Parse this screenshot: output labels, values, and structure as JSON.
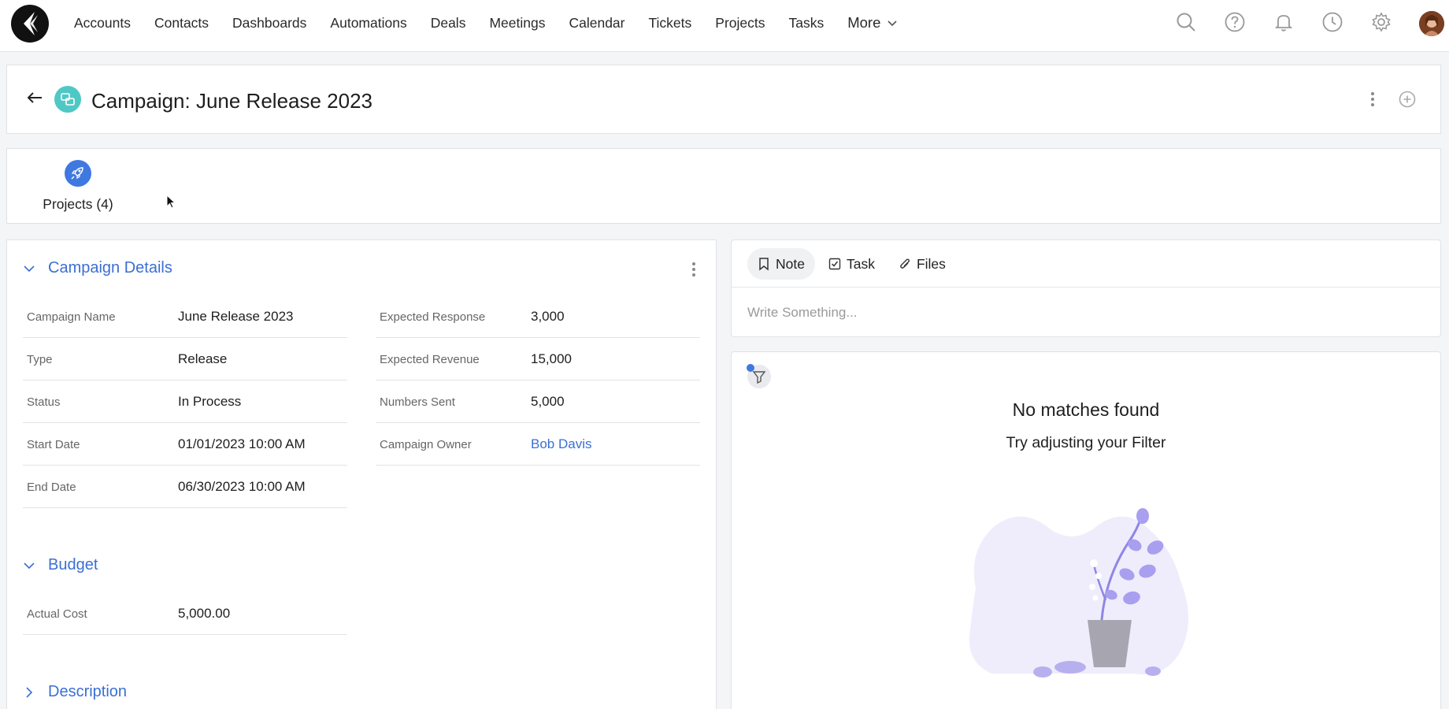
{
  "nav": {
    "items": [
      "Accounts",
      "Contacts",
      "Dashboards",
      "Automations",
      "Deals",
      "Meetings",
      "Calendar",
      "Tickets",
      "Projects",
      "Tasks"
    ],
    "more_label": "More",
    "icons": [
      "search-icon",
      "help-icon",
      "bell-icon",
      "clock-icon",
      "gear-icon"
    ]
  },
  "header": {
    "title": "Campaign: June Release 2023"
  },
  "related": {
    "projects_label": "Projects (4)"
  },
  "details": {
    "campaign_section_title": "Campaign Details",
    "left_fields": [
      {
        "label": "Campaign Name",
        "value": "June Release 2023"
      },
      {
        "label": "Type",
        "value": "Release"
      },
      {
        "label": "Status",
        "value": "In Process"
      },
      {
        "label": "Start Date",
        "value": "01/01/2023 10:00 AM"
      },
      {
        "label": "End Date",
        "value": "06/30/2023 10:00 AM"
      }
    ],
    "right_fields": [
      {
        "label": "Expected Response",
        "value": "3,000"
      },
      {
        "label": "Expected Revenue",
        "value": "15,000"
      },
      {
        "label": "Numbers Sent",
        "value": "5,000"
      },
      {
        "label": "Campaign Owner",
        "value": "Bob Davis"
      }
    ],
    "budget_section_title": "Budget",
    "budget_fields": [
      {
        "label": "Actual Cost",
        "value": "5,000.00"
      }
    ],
    "description_section_title": "Description"
  },
  "composer": {
    "tabs": [
      "Note",
      "Task",
      "Files"
    ],
    "active_tab": "Note",
    "placeholder": "Write Something..."
  },
  "timeline": {
    "empty_title": "No matches found",
    "empty_subtitle": "Try adjusting your Filter"
  },
  "colors": {
    "accent": "#3b6fd4",
    "campaign_icon": "#4fc8c5",
    "projects_icon": "#3f78e0"
  }
}
